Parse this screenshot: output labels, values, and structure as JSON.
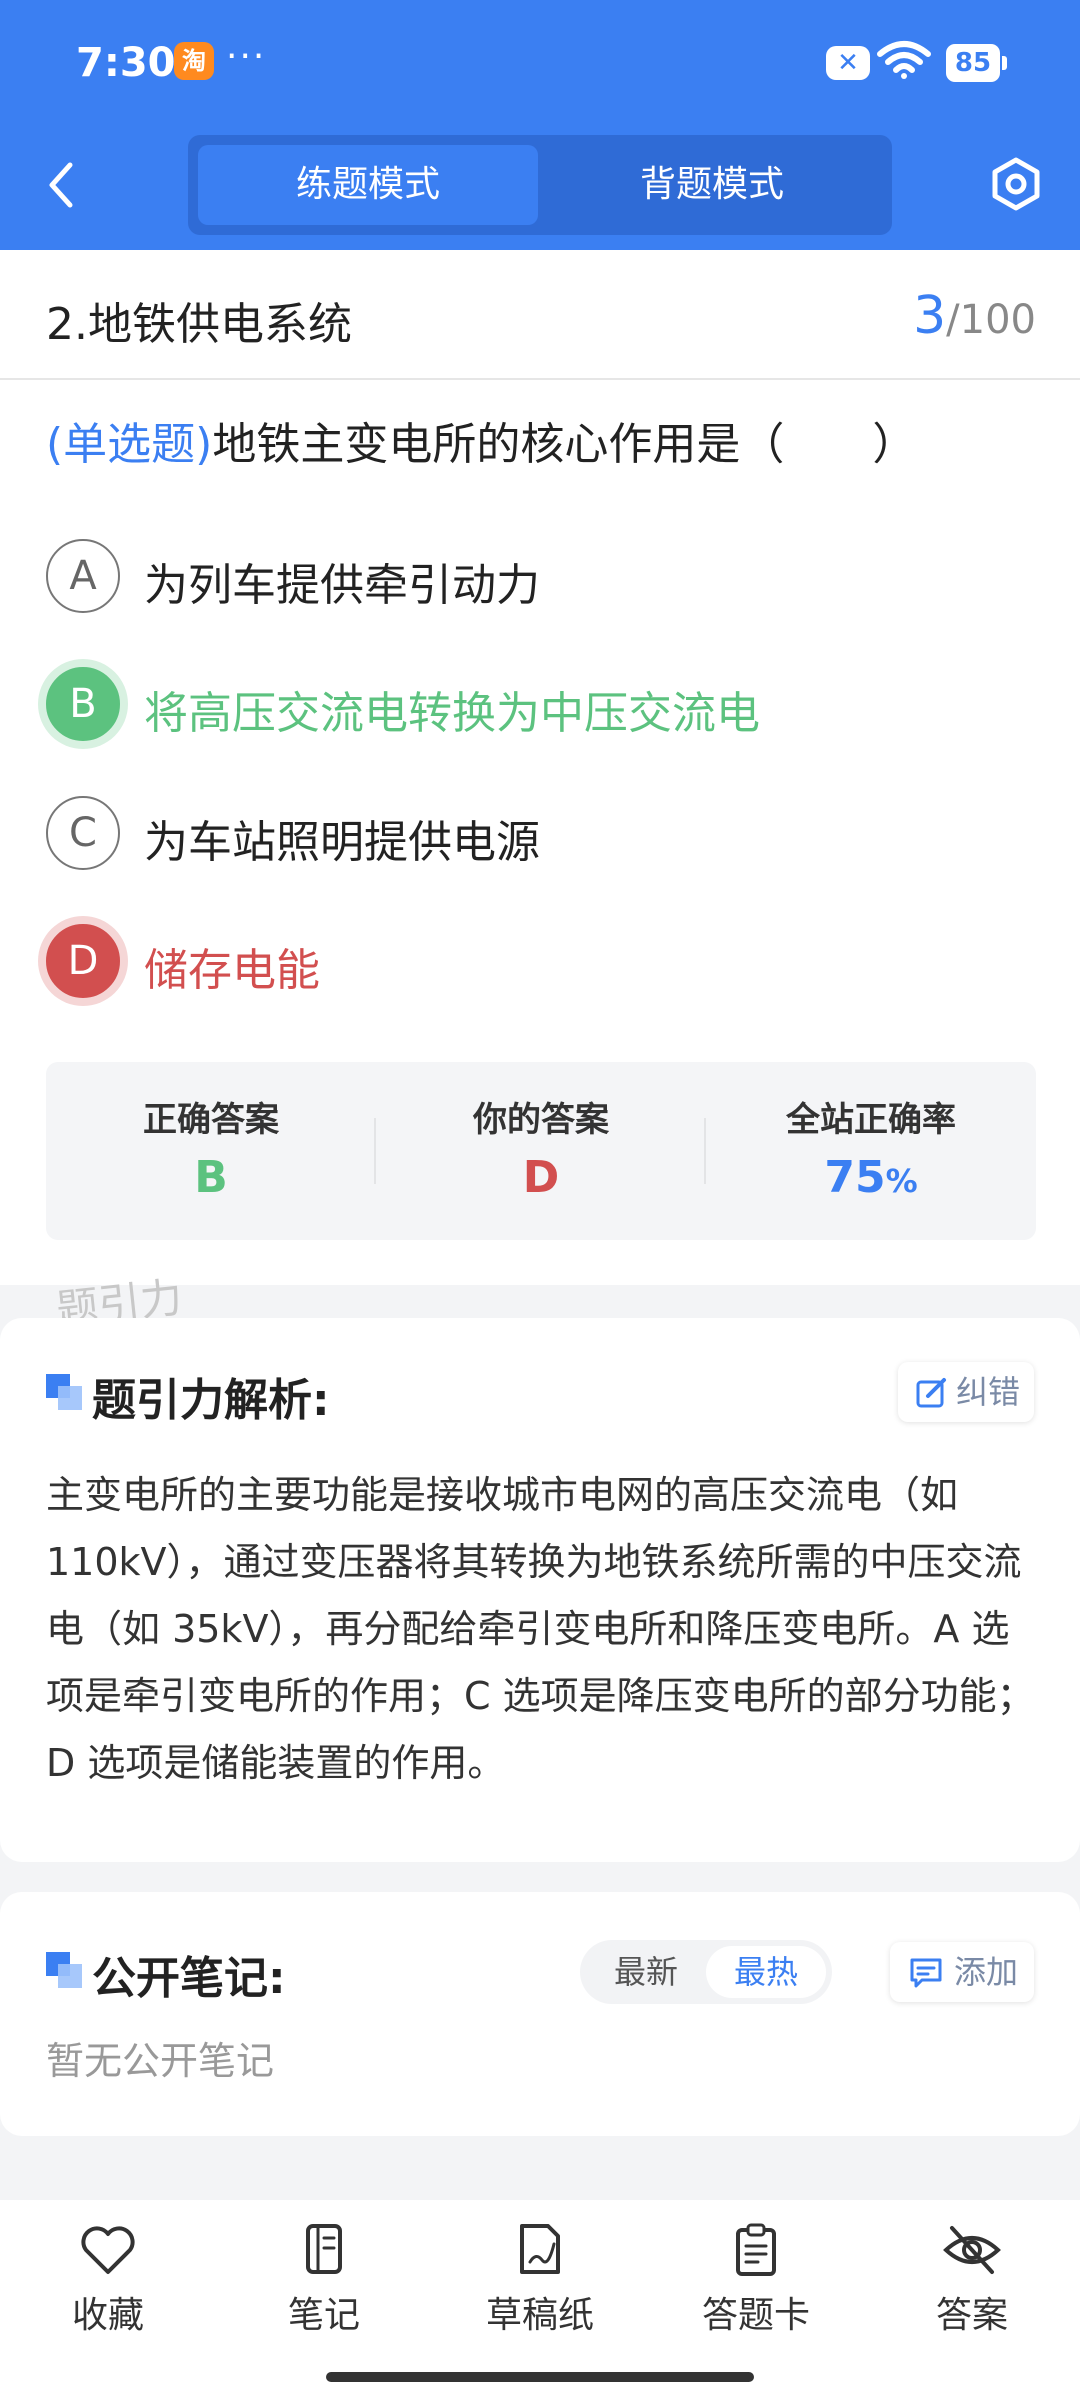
{
  "status_bar": {
    "time": "7:30",
    "app_badge": "淘",
    "more": "···",
    "battery": "85"
  },
  "header": {
    "tabs": [
      {
        "label": "练题模式",
        "active": true
      },
      {
        "label": "背题模式",
        "active": false
      }
    ]
  },
  "question": {
    "section": "2.地铁供电系统",
    "progress_current": "3",
    "progress_total": "/100",
    "type_tag": "(单选题)",
    "text": "地铁主变电所的核心作用是（　　）",
    "options": [
      {
        "letter": "A",
        "text": "为列车提供牵引动力",
        "state": "normal"
      },
      {
        "letter": "B",
        "text": "将高压交流电转换为中压交流电",
        "state": "correct"
      },
      {
        "letter": "C",
        "text": "为车站照明提供电源",
        "state": "normal"
      },
      {
        "letter": "D",
        "text": "储存电能",
        "state": "wrong"
      }
    ]
  },
  "answer_summary": {
    "correct_label": "正确答案",
    "correct_value": "B",
    "yours_label": "你的答案",
    "yours_value": "D",
    "rate_label": "全站正确率",
    "rate_value": "75",
    "rate_unit": "%"
  },
  "watermark": "题引力",
  "analysis": {
    "title": "题引力解析:",
    "correct_button": "纠错",
    "text": "主变电所的主要功能是接收城市电网的高压交流电（如 110kV），通过变压器将其转换为地铁系统所需的中压交流电（如 35kV），再分配给牵引变电所和降压变电所。A 选项是牵引变电所的作用；C 选项是降压变电所的部分功能；D 选项是储能装置的作用。"
  },
  "notes": {
    "title": "公开笔记:",
    "sort_new": "最新",
    "sort_hot": "最热",
    "add_button": "添加",
    "empty": "暂无公开笔记"
  },
  "bottom_nav": [
    {
      "label": "收藏",
      "icon": "heart-icon"
    },
    {
      "label": "笔记",
      "icon": "notebook-icon"
    },
    {
      "label": "草稿纸",
      "icon": "draft-icon"
    },
    {
      "label": "答题卡",
      "icon": "clipboard-icon"
    },
    {
      "label": "答案",
      "icon": "eye-off-icon"
    }
  ],
  "colors": {
    "primary": "#3b7ff2",
    "correct": "#5cc27f",
    "wrong": "#d24f4f"
  }
}
